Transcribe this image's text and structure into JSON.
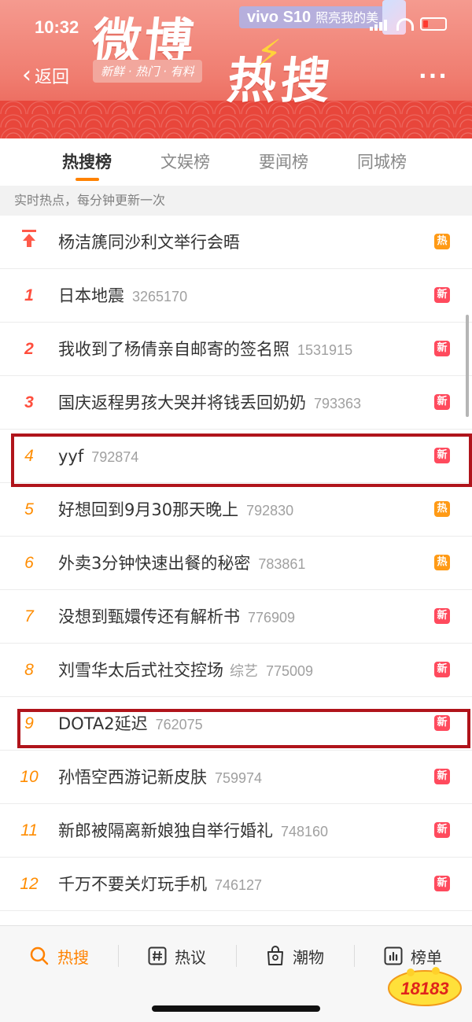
{
  "status": {
    "time": "10:32"
  },
  "header": {
    "back_label": "返回",
    "title_part1": "微博",
    "title_part2": "热搜",
    "slogan": "新鲜 · 热门 · 有料",
    "ad_brand": "vivo S10",
    "ad_text": "照亮我的美",
    "more_label": "···"
  },
  "tabs": [
    {
      "label": "热搜榜",
      "active": true
    },
    {
      "label": "文娱榜",
      "active": false
    },
    {
      "label": "要闻榜",
      "active": false
    },
    {
      "label": "同城榜",
      "active": false
    }
  ],
  "subheader": "实时热点，每分钟更新一次",
  "list": {
    "pinned": {
      "icon": "pin-top-icon",
      "title": "杨洁篪同沙利文举行会晤",
      "badge": "热"
    },
    "items": [
      {
        "rank": "1",
        "title": "日本地震",
        "count": "3265170",
        "badge": "新"
      },
      {
        "rank": "2",
        "title": "我收到了杨倩亲自邮寄的签名照",
        "count": "1531915",
        "badge": "新"
      },
      {
        "rank": "3",
        "title": "国庆返程男孩大哭并将钱丢回奶奶",
        "count": "793363",
        "badge": "新"
      },
      {
        "rank": "4",
        "title": "yyf",
        "count": "792874",
        "badge": "新"
      },
      {
        "rank": "5",
        "title": "好想回到9月30那天晚上",
        "count": "792830",
        "badge": "热"
      },
      {
        "rank": "6",
        "title": "外卖3分钟快速出餐的秘密",
        "count": "783861",
        "badge": "热"
      },
      {
        "rank": "7",
        "title": "没想到甄嬛传还有解析书",
        "count": "776909",
        "badge": "新"
      },
      {
        "rank": "8",
        "title": "刘雪华太后式社交控场",
        "category": "综艺",
        "count": "775009",
        "badge": "新"
      },
      {
        "rank": "9",
        "title": "DOTA2延迟",
        "count": "762075",
        "badge": "新"
      },
      {
        "rank": "10",
        "title": "孙悟空西游记新皮肤",
        "count": "759974",
        "badge": "新"
      },
      {
        "rank": "11",
        "title": "新郎被隔离新娘独自举行婚礼",
        "count": "748160",
        "badge": "新"
      },
      {
        "rank": "12",
        "title": "千万不要关灯玩手机",
        "count": "746127",
        "badge": "新"
      }
    ]
  },
  "bottom_nav": [
    {
      "label": "热搜",
      "icon": "search-icon",
      "active": true
    },
    {
      "label": "热议",
      "icon": "hashtag-icon",
      "active": false
    },
    {
      "label": "潮物",
      "icon": "shopping-bag-icon",
      "active": false
    },
    {
      "label": "榜单",
      "icon": "bar-chart-icon",
      "active": false
    }
  ],
  "watermark": "18183",
  "colors": {
    "accent": "#ff8200",
    "new_badge": "#ff4a5d",
    "hot_badge": "#ff9a15",
    "highlight_box": "#b0141b"
  }
}
